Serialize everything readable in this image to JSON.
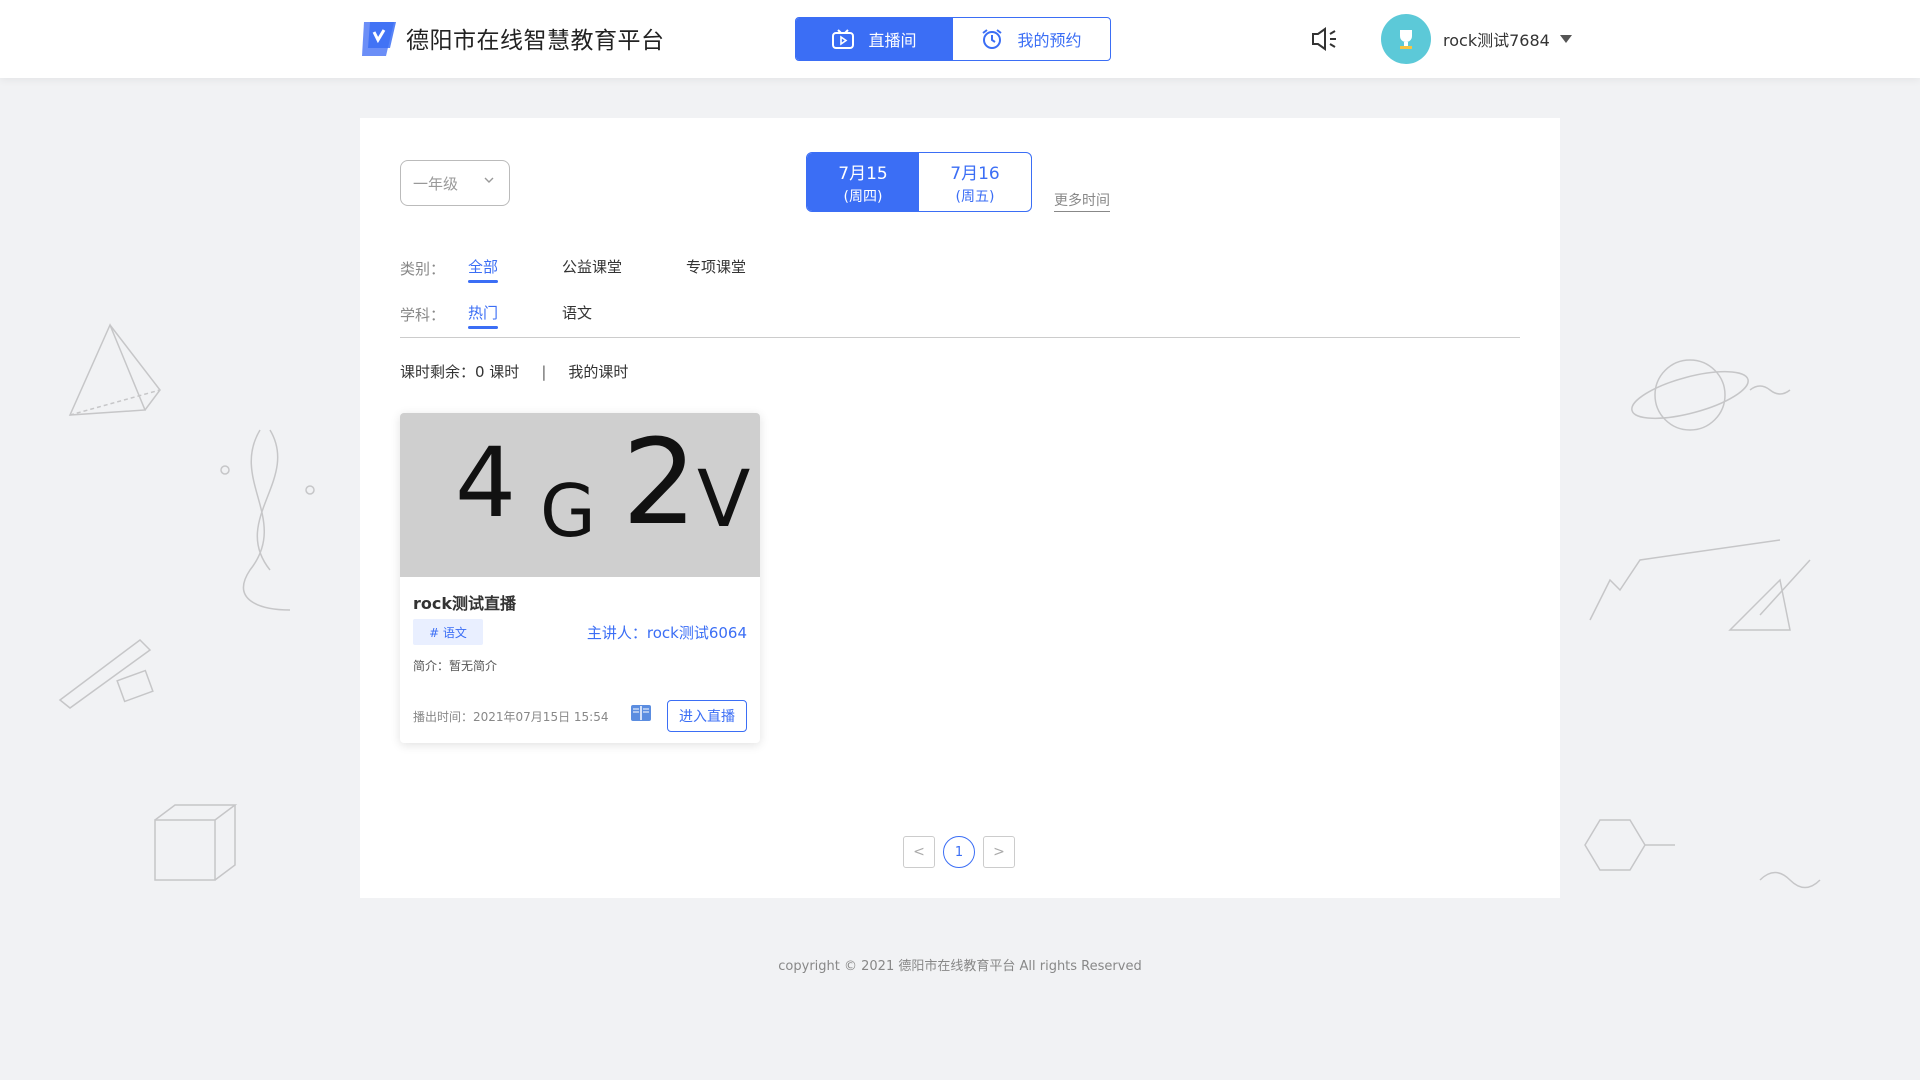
{
  "header": {
    "site_title": "德阳市在线智慧教育平台",
    "tabs": [
      {
        "label": "直播间",
        "active": true
      },
      {
        "label": "我的预约",
        "active": false
      }
    ],
    "username": "rock测试7684"
  },
  "filters": {
    "grade_value": "一年级",
    "dates": [
      {
        "date": "7月15",
        "weekday": "(周四)",
        "active": true
      },
      {
        "date": "7月16",
        "weekday": "(周五)",
        "active": false
      }
    ],
    "more_time": "更多时间",
    "category_label": "类别：",
    "categories": [
      "全部",
      "公益课堂",
      "专项课堂"
    ],
    "subject_label": "学科：",
    "subjects": [
      "热门",
      "语文"
    ]
  },
  "hours": {
    "remaining": "课时剩余：0 课时",
    "separator": "|",
    "my_hours": "我的课时"
  },
  "card": {
    "thumb_text": [
      "4",
      "G",
      "2",
      "V"
    ],
    "title": "rock测试直播",
    "tag": "# 语文",
    "host": "主讲人：rock测试6064",
    "intro": "简介：暂无简介",
    "time": "播出时间：2021年07月15日 15:54",
    "enter_label": "进入直播"
  },
  "pagination": {
    "prev": "<",
    "current": "1",
    "next": ">"
  },
  "footer": {
    "copyright": "copyright © 2021 德阳市在线教育平台 All rights Reserved"
  },
  "colors": {
    "primary": "#3b6ef5",
    "background": "#f1f2f4",
    "avatar": "#5cc9d8"
  }
}
